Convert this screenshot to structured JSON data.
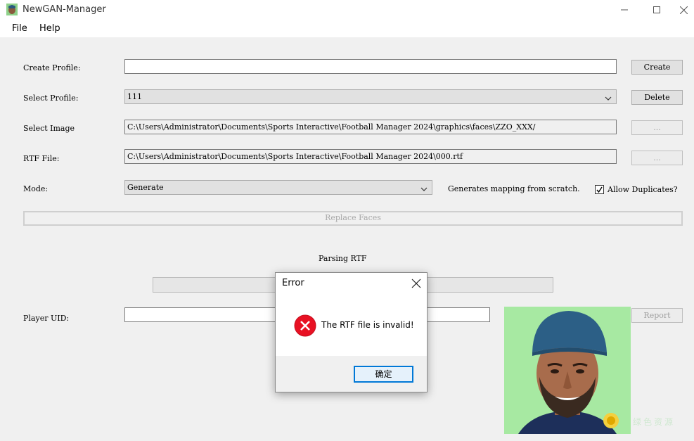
{
  "window": {
    "title": "NewGAN-Manager"
  },
  "menu": {
    "file": "File",
    "help": "Help"
  },
  "form": {
    "create_profile_label": "Create Profile:",
    "create_profile_value": "",
    "create_button": "Create",
    "select_profile_label": "Select Profile:",
    "select_profile_value": "111",
    "delete_button": "Delete",
    "select_image_label": "Select Image",
    "select_image_value": "C:\\Users\\Administrator\\Documents\\Sports Interactive\\Football Manager 2024\\graphics\\faces\\ZZO_XXX/",
    "browse_image_button": "...",
    "rtf_file_label": "RTF File:",
    "rtf_file_value": "C:\\Users\\Administrator\\Documents\\Sports Interactive\\Football Manager 2024\\000.rtf",
    "browse_rtf_button": "...",
    "mode_label": "Mode:",
    "mode_value": "Generate",
    "mode_description": "Generates mapping from scratch.",
    "allow_duplicates_label": "Allow Duplicates?",
    "allow_duplicates_checked": true,
    "replace_faces_button": "Replace Faces",
    "status_text": "Parsing RTF",
    "progress_fraction": 0,
    "player_uid_label": "Player UID:",
    "player_uid_value": "",
    "report_button": "Report"
  },
  "dialog": {
    "title": "Error",
    "message": "The RTF file is invalid!",
    "ok_button": "确定",
    "icon": "error-icon",
    "error_color": "#e81123"
  },
  "watermark": "绿色资源"
}
